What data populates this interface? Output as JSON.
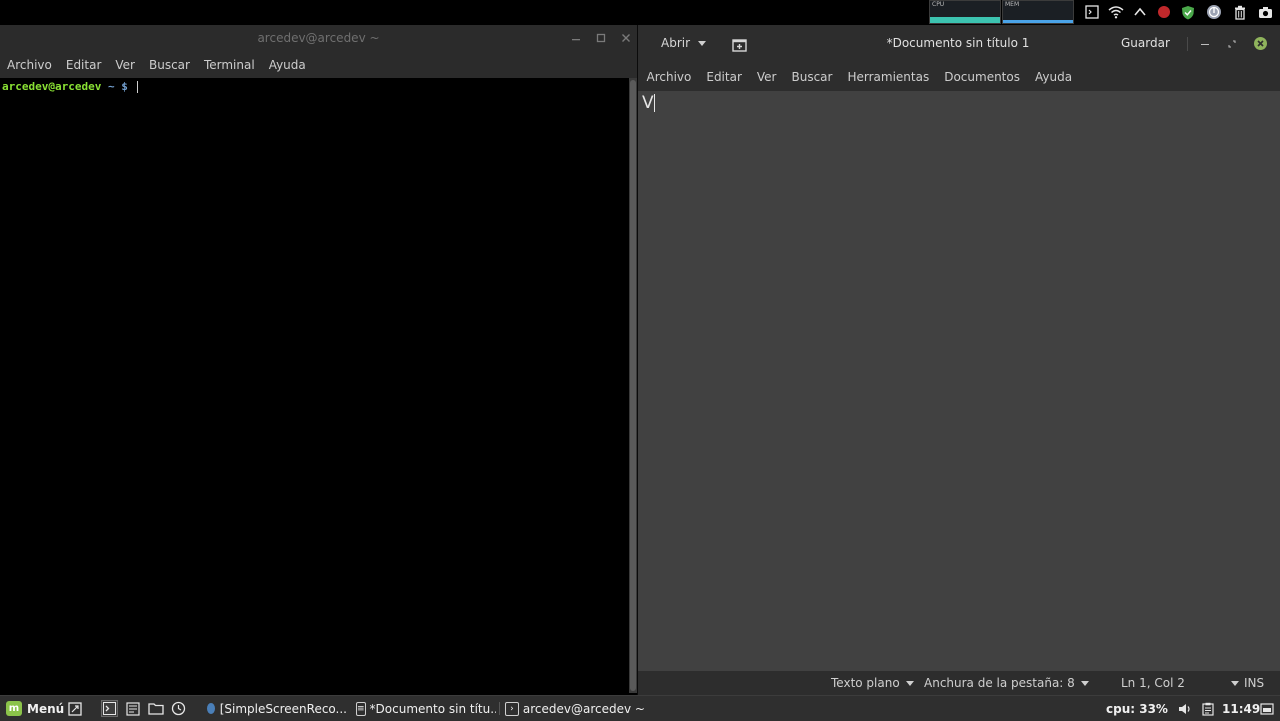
{
  "top_panel": {
    "cpu_graph_label": "CPU",
    "mem_graph_label": "MEM",
    "colors": {
      "cpu_fill": "#3cc3b0",
      "mem_fill": "#4aa3e8"
    }
  },
  "terminal": {
    "title": "arcedev@arcedev ~",
    "menu": [
      "Archivo",
      "Editar",
      "Ver",
      "Buscar",
      "Terminal",
      "Ayuda"
    ],
    "prompt_user": "arcedev@arcedev",
    "prompt_path": "~ $",
    "colors": {
      "user": "#8ae234",
      "path": "#729fcf"
    }
  },
  "editor": {
    "open_label": "Abrir",
    "doc_title": "*Documento sin título 1",
    "save_label": "Guardar",
    "menu": [
      "Archivo",
      "Editar",
      "Ver",
      "Buscar",
      "Herramientas",
      "Documentos",
      "Ayuda"
    ],
    "content": "V",
    "status": {
      "language": "Texto plano",
      "tab_width": "Anchura de la pestaña: 8",
      "position": "Ln 1, Col 2",
      "mode": "INS"
    }
  },
  "taskbar": {
    "menu_label": "Menú",
    "tasks": [
      "[SimpleScreenReco...",
      "*Documento sin títu...",
      "arcedev@arcedev ~"
    ],
    "cpu_label": "cpu: 33%",
    "clock": "11:49"
  }
}
